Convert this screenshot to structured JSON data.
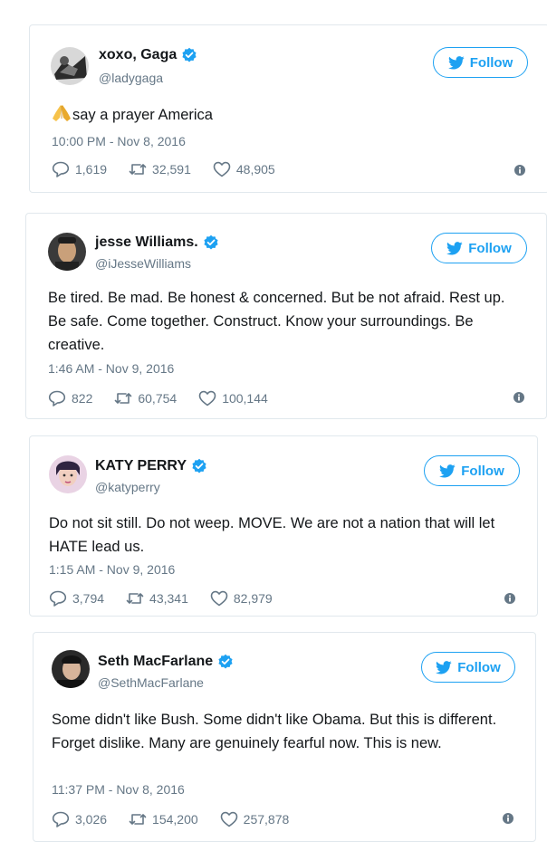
{
  "colors": {
    "accent": "#1da1f2",
    "secondary_text": "#657786",
    "primary_text": "#14171a",
    "border": "#e1e8ed"
  },
  "tweets": [
    {
      "name": "xoxo, Gaga",
      "handle": "@ladygaga",
      "follow_label": "Follow",
      "text": "say a prayer America",
      "leading_emoji": "folded-hands-emoji",
      "timestamp": "10:00 PM - Nov 8, 2016",
      "replies": "1,619",
      "retweets": "32,591",
      "likes": "48,905"
    },
    {
      "name": "jesse Williams.",
      "handle": "@iJesseWilliams",
      "follow_label": "Follow",
      "text": "Be tired. Be mad. Be honest & concerned. But be not afraid. Rest up. Be safe. Come together. Construct. Know your surroundings. Be creative.",
      "timestamp": "1:46 AM - Nov 9, 2016",
      "replies": "822",
      "retweets": "60,754",
      "likes": "100,144"
    },
    {
      "name": "KATY PERRY",
      "handle": "@katyperry",
      "follow_label": "Follow",
      "text": "Do not sit still. Do not weep. MOVE. We are not a nation that will let HATE lead us.",
      "timestamp": "1:15 AM - Nov 9, 2016",
      "replies": "3,794",
      "retweets": "43,341",
      "likes": "82,979"
    },
    {
      "name": "Seth MacFarlane",
      "handle": "@SethMacFarlane",
      "follow_label": "Follow",
      "text": "Some didn't like Bush. Some didn't like Obama. But this is different. Forget dislike. Many are genuinely fearful now. This is new.",
      "timestamp": "11:37 PM - Nov 8, 2016",
      "replies": "3,026",
      "retweets": "154,200",
      "likes": "257,878"
    }
  ]
}
